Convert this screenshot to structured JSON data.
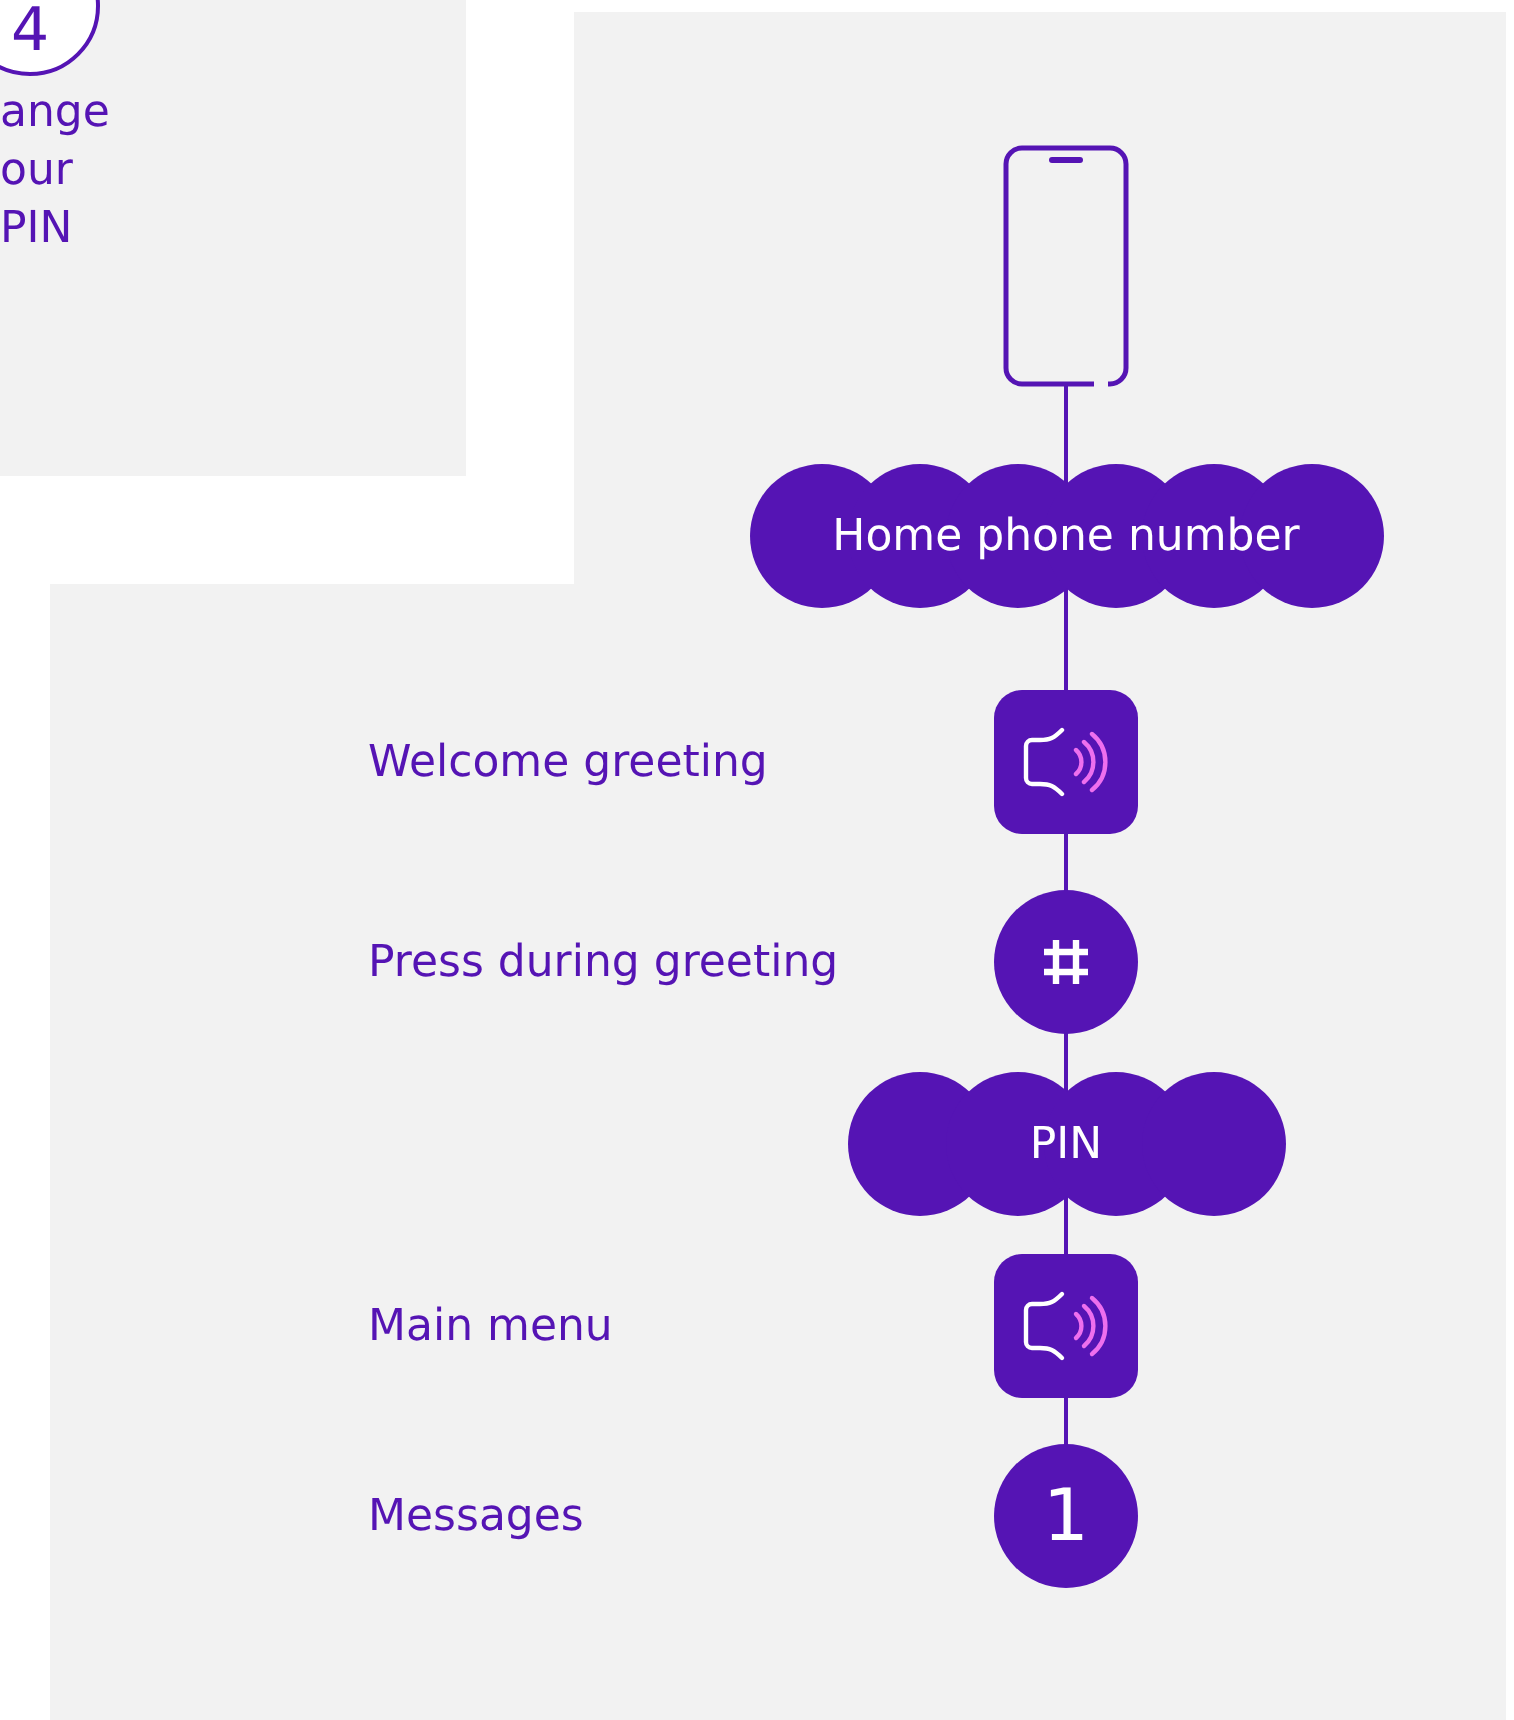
{
  "step_card": {
    "number": "4",
    "title_lines": [
      "ange",
      "our",
      "PIN"
    ]
  },
  "flow": [
    {
      "kind": "phone"
    },
    {
      "kind": "bubble",
      "text": "Home phone number"
    },
    {
      "kind": "speaker",
      "label": "Welcome greeting"
    },
    {
      "kind": "hash",
      "label": "Press during greeting"
    },
    {
      "kind": "bubble",
      "text": "PIN"
    },
    {
      "kind": "speaker",
      "label": "Main menu"
    },
    {
      "kind": "key",
      "key": "1",
      "label": "Messages"
    }
  ]
}
